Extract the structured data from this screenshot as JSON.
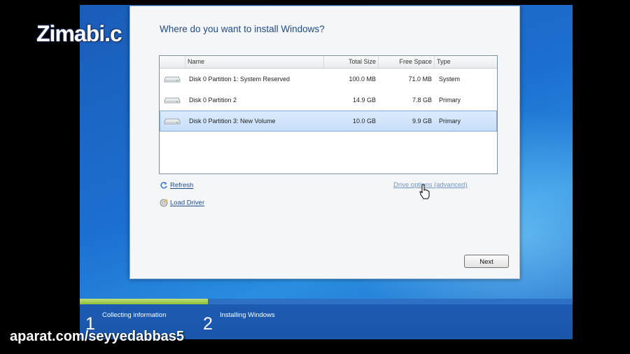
{
  "watermarks": {
    "top_left": "Zimabi.c",
    "bottom": "aparat.com/seyyedabbas5"
  },
  "dialog": {
    "heading": "Where do you want to install Windows?",
    "columns": {
      "name": "Name",
      "total_size": "Total Size",
      "free_space": "Free Space",
      "type": "Type"
    },
    "rows": [
      {
        "name": "Disk 0 Partition 1: System Reserved",
        "total_size": "100.0 MB",
        "free_space": "71.0 MB",
        "type": "System",
        "selected": false
      },
      {
        "name": "Disk 0 Partition 2",
        "total_size": "14.9 GB",
        "free_space": "7.8 GB",
        "type": "Primary",
        "selected": false
      },
      {
        "name": "Disk 0 Partition 3: New Volume",
        "total_size": "10.0 GB",
        "free_space": "9.9 GB",
        "type": "Primary",
        "selected": true
      }
    ],
    "links": {
      "refresh": "Refresh",
      "load_driver": "Load Driver",
      "drive_options": "Drive options (advanced)"
    },
    "next_button": "Next"
  },
  "progress": {
    "fill_fraction": 0.26,
    "steps": [
      {
        "number": "1",
        "label": "Collecting information"
      },
      {
        "number": "2",
        "label": "Installing Windows"
      }
    ]
  },
  "colors": {
    "accent_link": "#1f4a8c",
    "selection": "#c7defa",
    "progress_fill": "#8fbf3a"
  },
  "icons": {
    "disk": "hard-disk-icon",
    "refresh": "refresh-icon",
    "load_driver": "load-driver-icon",
    "cursor": "pointer-cursor-icon"
  }
}
